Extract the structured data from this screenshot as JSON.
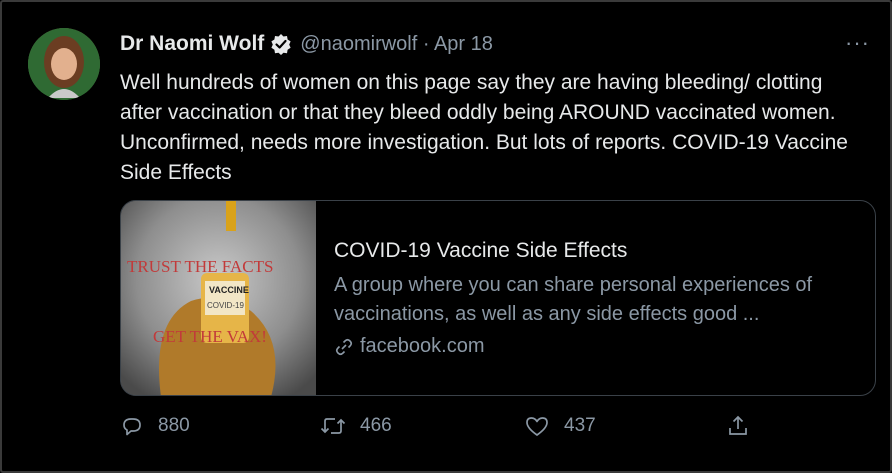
{
  "tweet": {
    "author_name": "Dr Naomi Wolf",
    "handle_date": "@naomirwolf · Apr 18",
    "more_label": "···",
    "text": "Well hundreds of women on this page say they are having bleeding/ clotting after vaccination or that they bleed oddly being AROUND vaccinated women. Unconfirmed, needs more investigation. But lots of reports. COVID-19 Vaccine Side Effects"
  },
  "card": {
    "image_top_text": "TRUST THE FACTS",
    "image_bottom_text": "GET THE VAX!",
    "vial_label_1": "VACCINE",
    "vial_label_2": "COVID-19",
    "title": "COVID-19 Vaccine Side Effects",
    "description": "A group where you can share personal experiences of vaccinations, as well as any side effects good ...",
    "link": "facebook.com"
  },
  "actions": {
    "replies": "880",
    "retweets": "466",
    "likes": "437"
  },
  "colors": {
    "background": "#000000",
    "text": "#e7e9ea",
    "muted": "#8b98a5",
    "verified": "#e7e9ea"
  }
}
